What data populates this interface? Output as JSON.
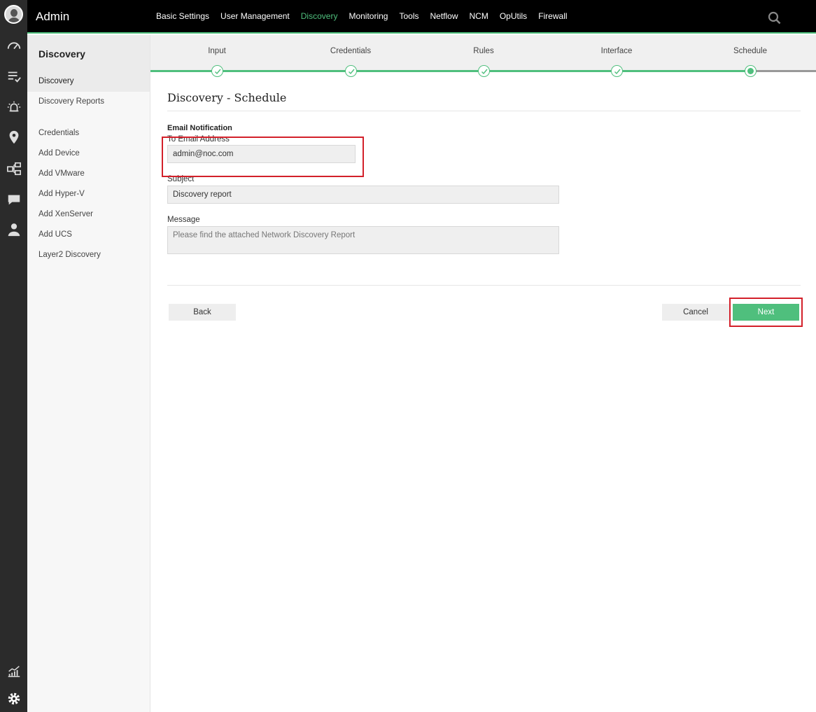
{
  "app": {
    "title": "Admin"
  },
  "topnav": {
    "items": [
      "Basic Settings",
      "User Management",
      "Discovery",
      "Monitoring",
      "Tools",
      "Netflow",
      "NCM",
      "OpUtils",
      "Firewall"
    ],
    "active": "Discovery"
  },
  "sidebar": {
    "header": "Discovery",
    "items": [
      "Discovery",
      "Discovery Reports",
      "Credentials",
      "Add Device",
      "Add VMware",
      "Add Hyper-V",
      "Add XenServer",
      "Add UCS",
      "Layer2 Discovery"
    ]
  },
  "stepper": {
    "steps": [
      "Input",
      "Credentials",
      "Rules",
      "Interface",
      "Schedule"
    ],
    "current": "Schedule"
  },
  "form": {
    "title": "Discovery - Schedule",
    "section": "Email Notification",
    "to_label": "To Email Address",
    "to_value": "admin@noc.com",
    "subject_label": "Subject",
    "subject_value": "Discovery report",
    "message_label": "Message",
    "message_value": "Please find the attached Network Discovery Report"
  },
  "buttons": {
    "back": "Back",
    "cancel": "Cancel",
    "next": "Next"
  },
  "colors": {
    "accent": "#4fbf7d",
    "highlight": "#d3202a",
    "topbar": "#000000",
    "rail": "#2b2b2b"
  }
}
